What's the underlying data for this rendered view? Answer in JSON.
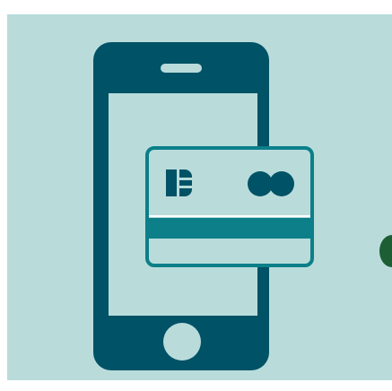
{
  "illustration": {
    "subject": "mobile-payment",
    "colors": {
      "background": "#ffffff",
      "panel": "#b9dcdb",
      "phone_body": "#005266",
      "card_fill": "#b9dcdb",
      "card_stripe": "#0c7f89",
      "chip_and_logo": "#005266",
      "accent_dot": "#1d5e35"
    },
    "icons": [
      "smartphone-icon",
      "credit-card-icon",
      "card-chip-icon",
      "card-brand-logo-icon",
      "home-button-icon",
      "speaker-slot-icon"
    ]
  }
}
